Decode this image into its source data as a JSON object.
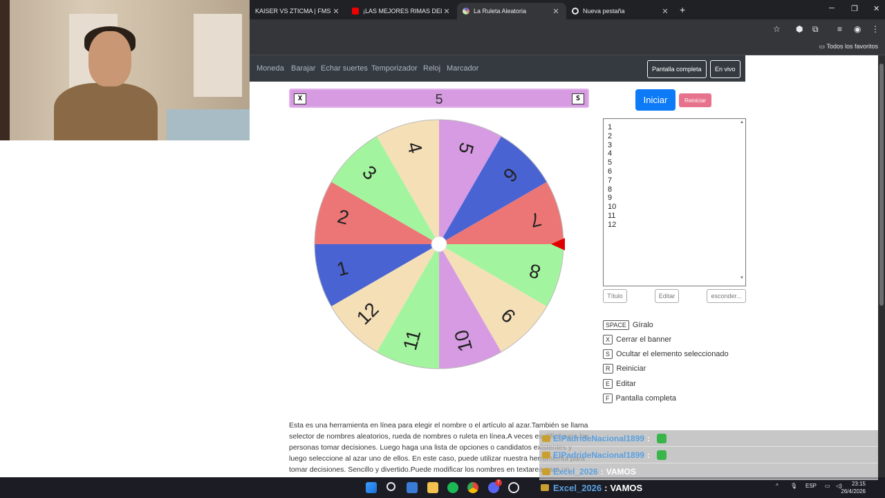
{
  "browser": {
    "tabs": [
      {
        "title": "KAISER VS ZTICMA | FMS INTERNACIONAL",
        "active": false
      },
      {
        "title": "¡LAS MEJORES RIMAS DEL AÑO",
        "active": false
      },
      {
        "title": "La Ruleta Aleatoria",
        "active": true
      },
      {
        "title": "Nueva pestaña",
        "active": false
      }
    ],
    "new_tab": "+",
    "bookmarks_all": "Todos los favoritos"
  },
  "nav": {
    "links": [
      "Moneda",
      "Barajar",
      "Echar suertes",
      "Temporizador",
      "Reloj",
      "Marcador"
    ],
    "fullscreen": "Pantalla completa",
    "live": "En vivo"
  },
  "banner": {
    "close_key": "X",
    "hide_key": "S",
    "value": "5"
  },
  "wheel": {
    "segments": [
      {
        "label": "1",
        "color": "#4a63d3"
      },
      {
        "label": "2",
        "color": "#ec7676"
      },
      {
        "label": "3",
        "color": "#a2f59e"
      },
      {
        "label": "4",
        "color": "#f5dfb7"
      },
      {
        "label": "5",
        "color": "#d69be2"
      },
      {
        "label": "6",
        "color": "#4a63d3"
      },
      {
        "label": "7",
        "color": "#ec7676"
      },
      {
        "label": "8",
        "color": "#a2f59e"
      },
      {
        "label": "9",
        "color": "#f5dfb7"
      },
      {
        "label": "10",
        "color": "#d69be2"
      },
      {
        "label": "11",
        "color": "#a2f59e"
      },
      {
        "label": "12",
        "color": "#f5dfb7"
      }
    ],
    "pointer_color": "#e00000"
  },
  "controls": {
    "start": "Iniciar",
    "reset": "Reiniciar"
  },
  "list": {
    "items": [
      "1",
      "2",
      "3",
      "4",
      "5",
      "6",
      "7",
      "8",
      "9",
      "10",
      "11",
      "12"
    ]
  },
  "list_buttons": {
    "title": "Título",
    "edit": "Editar",
    "hide": "esconder..."
  },
  "shortcuts": [
    {
      "key": "SPACE",
      "label": "Gíralo"
    },
    {
      "key": "X",
      "label": "Cerrar el banner"
    },
    {
      "key": "S",
      "label": "Ocultar el elemento seleccionado"
    },
    {
      "key": "R",
      "label": "Reiniciar"
    },
    {
      "key": "E",
      "label": "Editar"
    },
    {
      "key": "F",
      "label": "Pantalla completa"
    }
  ],
  "description": "Esta es una herramienta en línea para elegir el nombre o el artículo al azar.También se llama selector de nombres aleatorios, rueda de nombres o ruleta en línea.A veces es difícil para las personas tomar decisiones. Luego haga una lista de opciones o candidatos existentes y luego seleccione al azar uno de ellos. En este caso, puede utilizar nuestra herramienta para tomar decisiones. Sencillo y divertido.Puede modificar los nombres en textarea para un",
  "chat": [
    {
      "user": "ElPadrideNacional1899",
      "sep": ":",
      "msg": ""
    },
    {
      "user": "ElPadrideNacional1899",
      "sep": ":",
      "msg": ""
    },
    {
      "user": "Excel_2026",
      "sep": ":",
      "msg": "VAMOS"
    }
  ],
  "taskbar": {
    "chat_user": "Excel_2026",
    "chat_sep": ":",
    "chat_msg": "VAMOS",
    "lang": "ESP",
    "time": "23:15",
    "date": "26/4/2026",
    "spotify_badge": "7"
  }
}
